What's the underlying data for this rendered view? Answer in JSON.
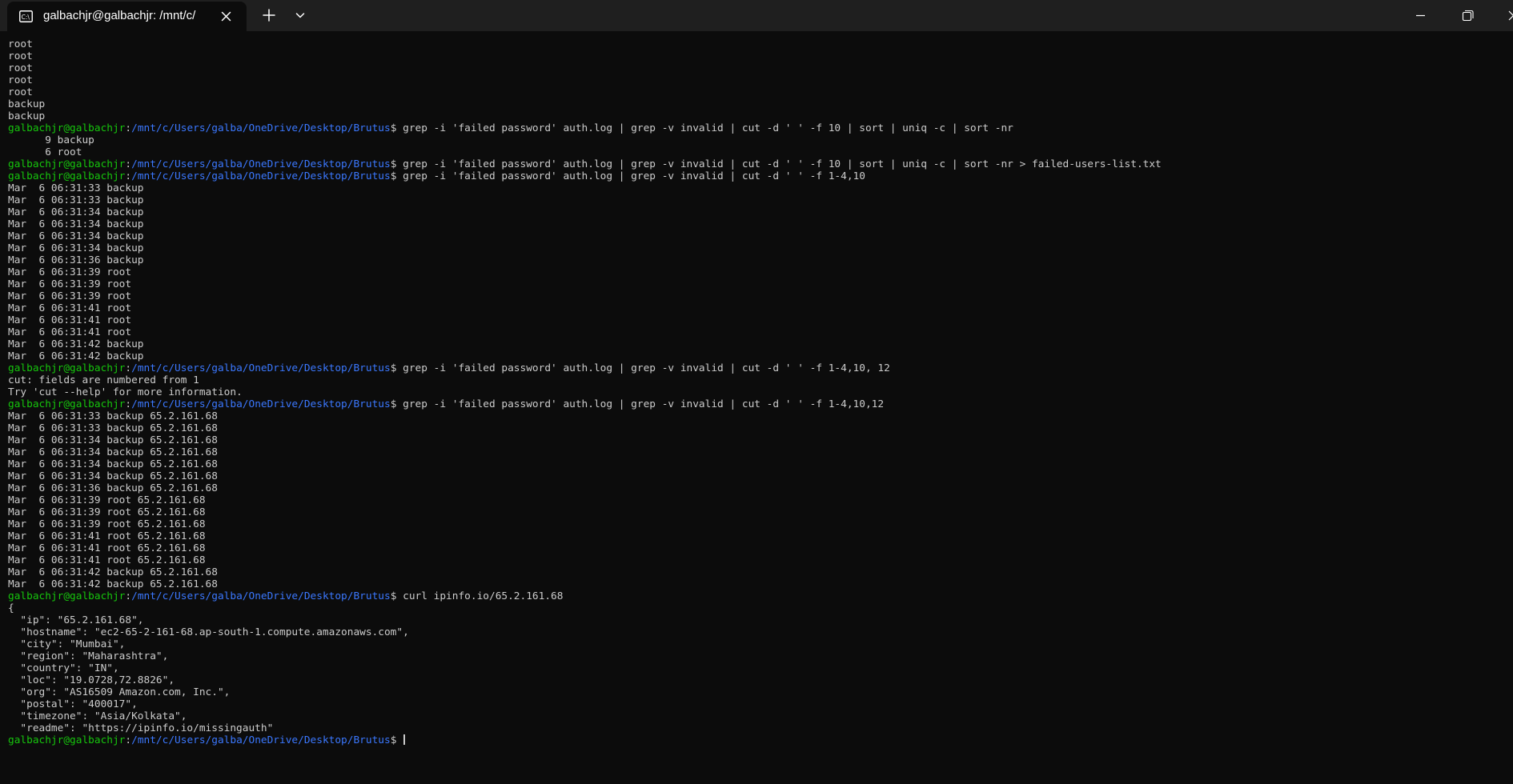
{
  "tab": {
    "title": "galbachjr@galbachjr: /mnt/c/",
    "icon": "terminal-icon"
  },
  "titlebar_icons": {
    "new_tab": "plus-icon",
    "dropdown": "chevron-down-icon",
    "minimize": "minimize-icon",
    "restore": "restore-icon",
    "close": "close-icon"
  },
  "colors": {
    "background": "#0c0c0c",
    "titlebar": "#1f1f1f",
    "text": "#cccccc",
    "prompt_user": "#16c60c",
    "prompt_path": "#3b78ff"
  },
  "terminal": {
    "lines": [
      {
        "text": "root"
      },
      {
        "text": "root"
      },
      {
        "text": "root"
      },
      {
        "text": "root"
      },
      {
        "text": "root"
      },
      {
        "text": "backup"
      },
      {
        "text": "backup"
      },
      {
        "user": "galbachjr@galbachjr",
        "path": "/mnt/c/Users/galba/OneDrive/Desktop/Brutus",
        "cmd": "grep -i 'failed password' auth.log | grep -v invalid | cut -d ' ' -f 10 | sort | uniq -c | sort -nr"
      },
      {
        "text": "      9 backup"
      },
      {
        "text": "      6 root"
      },
      {
        "user": "galbachjr@galbachjr",
        "path": "/mnt/c/Users/galba/OneDrive/Desktop/Brutus",
        "cmd": "grep -i 'failed password' auth.log | grep -v invalid | cut -d ' ' -f 10 | sort | uniq -c | sort -nr > failed-users-list.txt"
      },
      {
        "user": "galbachjr@galbachjr",
        "path": "/mnt/c/Users/galba/OneDrive/Desktop/Brutus",
        "cmd": "grep -i 'failed password' auth.log | grep -v invalid | cut -d ' ' -f 1-4,10"
      },
      {
        "text": "Mar  6 06:31:33 backup"
      },
      {
        "text": "Mar  6 06:31:33 backup"
      },
      {
        "text": "Mar  6 06:31:34 backup"
      },
      {
        "text": "Mar  6 06:31:34 backup"
      },
      {
        "text": "Mar  6 06:31:34 backup"
      },
      {
        "text": "Mar  6 06:31:34 backup"
      },
      {
        "text": "Mar  6 06:31:36 backup"
      },
      {
        "text": "Mar  6 06:31:39 root"
      },
      {
        "text": "Mar  6 06:31:39 root"
      },
      {
        "text": "Mar  6 06:31:39 root"
      },
      {
        "text": "Mar  6 06:31:41 root"
      },
      {
        "text": "Mar  6 06:31:41 root"
      },
      {
        "text": "Mar  6 06:31:41 root"
      },
      {
        "text": "Mar  6 06:31:42 backup"
      },
      {
        "text": "Mar  6 06:31:42 backup"
      },
      {
        "user": "galbachjr@galbachjr",
        "path": "/mnt/c/Users/galba/OneDrive/Desktop/Brutus",
        "cmd": "grep -i 'failed password' auth.log | grep -v invalid | cut -d ' ' -f 1-4,10, 12"
      },
      {
        "text": "cut: fields are numbered from 1"
      },
      {
        "text": "Try 'cut --help' for more information."
      },
      {
        "user": "galbachjr@galbachjr",
        "path": "/mnt/c/Users/galba/OneDrive/Desktop/Brutus",
        "cmd": "grep -i 'failed password' auth.log | grep -v invalid | cut -d ' ' -f 1-4,10,12"
      },
      {
        "text": "Mar  6 06:31:33 backup 65.2.161.68"
      },
      {
        "text": "Mar  6 06:31:33 backup 65.2.161.68"
      },
      {
        "text": "Mar  6 06:31:34 backup 65.2.161.68"
      },
      {
        "text": "Mar  6 06:31:34 backup 65.2.161.68"
      },
      {
        "text": "Mar  6 06:31:34 backup 65.2.161.68"
      },
      {
        "text": "Mar  6 06:31:34 backup 65.2.161.68"
      },
      {
        "text": "Mar  6 06:31:36 backup 65.2.161.68"
      },
      {
        "text": "Mar  6 06:31:39 root 65.2.161.68"
      },
      {
        "text": "Mar  6 06:31:39 root 65.2.161.68"
      },
      {
        "text": "Mar  6 06:31:39 root 65.2.161.68"
      },
      {
        "text": "Mar  6 06:31:41 root 65.2.161.68"
      },
      {
        "text": "Mar  6 06:31:41 root 65.2.161.68"
      },
      {
        "text": "Mar  6 06:31:41 root 65.2.161.68"
      },
      {
        "text": "Mar  6 06:31:42 backup 65.2.161.68"
      },
      {
        "text": "Mar  6 06:31:42 backup 65.2.161.68"
      },
      {
        "user": "galbachjr@galbachjr",
        "path": "/mnt/c/Users/galba/OneDrive/Desktop/Brutus",
        "cmd": "curl ipinfo.io/65.2.161.68"
      },
      {
        "text": "{"
      },
      {
        "text": "  \"ip\": \"65.2.161.68\","
      },
      {
        "text": "  \"hostname\": \"ec2-65-2-161-68.ap-south-1.compute.amazonaws.com\","
      },
      {
        "text": "  \"city\": \"Mumbai\","
      },
      {
        "text": "  \"region\": \"Maharashtra\","
      },
      {
        "text": "  \"country\": \"IN\","
      },
      {
        "text": "  \"loc\": \"19.0728,72.8826\","
      },
      {
        "text": "  \"org\": \"AS16509 Amazon.com, Inc.\","
      },
      {
        "text": "  \"postal\": \"400017\","
      },
      {
        "text": "  \"timezone\": \"Asia/Kolkata\","
      },
      {
        "text": "  \"readme\": \"https://ipinfo.io/missingauth\""
      },
      {
        "user": "galbachjr@galbachjr",
        "path": "/mnt/c/Users/galba/OneDrive/Desktop/Brutus",
        "cmd": "",
        "cursor": true
      }
    ]
  }
}
